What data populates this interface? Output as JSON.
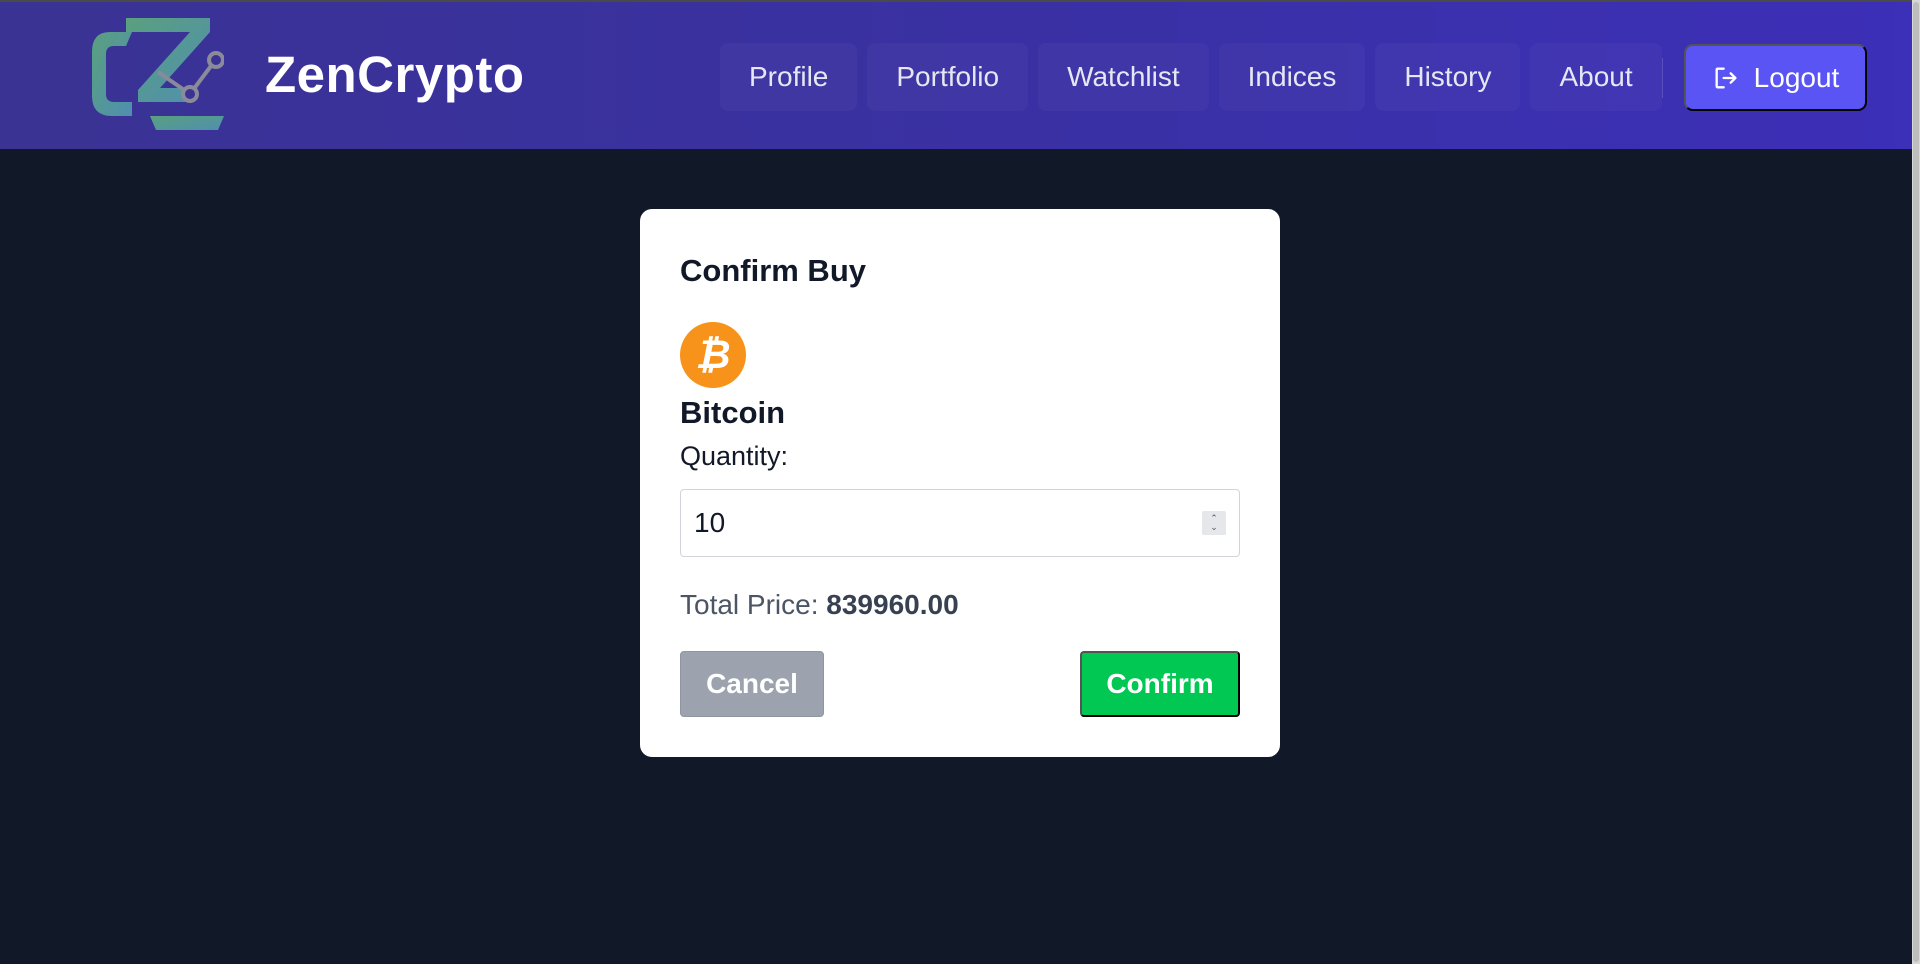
{
  "app": {
    "brand_name": "ZenCrypto",
    "logo_icon": "zencrypto-logo"
  },
  "nav": {
    "items": [
      "Profile",
      "Portfolio",
      "Watchlist",
      "Indices",
      "History",
      "About"
    ],
    "logout_label": "Logout",
    "logout_icon": "logout-icon"
  },
  "modal": {
    "title": "Confirm Buy",
    "coin_name": "Bitcoin",
    "coin_icon": "bitcoin-icon",
    "quantity_label": "Quantity:",
    "quantity_value": "10",
    "total_label": "Total Price:",
    "total_value": "839960.00",
    "cancel_label": "Cancel",
    "confirm_label": "Confirm"
  },
  "colors": {
    "nav_bg": "#3a30a6",
    "logout_bg": "#5a54f5",
    "page_bg": "#111827",
    "confirm_bg": "#00c853",
    "cancel_bg": "#9ca3af",
    "bitcoin_orange": "#f7931a"
  }
}
